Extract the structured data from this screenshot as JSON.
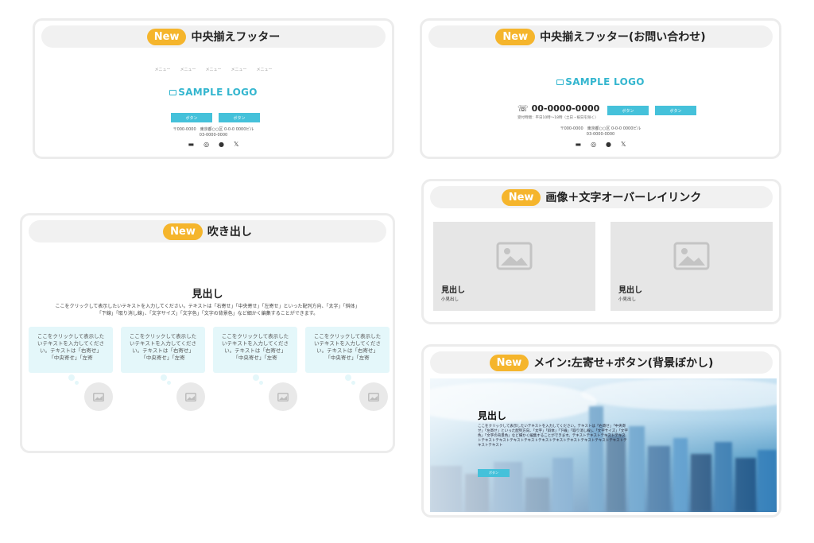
{
  "cards": {
    "footer_center": {
      "badge": "New",
      "title": "中央揃えフッター"
    },
    "footer_contact": {
      "badge": "New",
      "title": "中央揃えフッター(お問い合わせ)"
    },
    "overlay": {
      "badge": "New",
      "title": "画像＋文字オーバーレイリンク"
    },
    "bubble": {
      "badge": "New",
      "title": "吹き出し"
    },
    "hero": {
      "badge": "New",
      "title": "メイン:左寄せ+ボタン(背景ぼかし)"
    }
  },
  "footer": {
    "nav_items": [
      "メニュー",
      "メニュー",
      "メニュー",
      "メニュー",
      "メニュー"
    ],
    "logo": "SAMPLE LOGO",
    "button_label": "ボタン",
    "address_line1": "〒000-0000　東京都○○区 0-0-0 0000ビル",
    "address_line2": "03-0000-0000",
    "phone": "00-0000-0000",
    "phone_sub": "受付時間：平日10時〜18時（土日・祝日を除く）"
  },
  "bubble_section": {
    "heading": "見出し",
    "paragraph_line1": "ここをクリックして表示したいテキストを入力してください。テキストは「右寄せ」「中央寄せ」「左寄せ」といった配列方向、「太字」「斜体」",
    "paragraph_line2": "「下線」「取り消し線」、「文字サイズ」「文字色」「文字の背景色」など細かく編集することができます。",
    "bubble_text": "ここをクリックして表示したいテキストを入力してください。テキストは「右寄せ」「中央寄せ」「左寄"
  },
  "overlay_section": {
    "items": [
      {
        "heading": "見出し",
        "sub": "小見出し"
      },
      {
        "heading": "見出し",
        "sub": "小見出し"
      }
    ]
  },
  "hero_section": {
    "heading": "見出し",
    "paragraph": "ここをクリックして表示したいテキストを入力してください。テキストは「右寄せ」「中央寄せ」「左寄せ」といった配列方向、「太字」「斜体」「下線」「取り消し線」、「文字サイズ」「文字色」「文字の背景色」など細かく編集することができます。テキストテキストテキストテキストテキストテキストテキストテキストテキストテキストテキストテキストテキストテキストテキストテキスト",
    "button_label": "ボタン"
  },
  "colors": {
    "badge": "#f5b52c",
    "accent": "#45c1da",
    "logo": "#34b6cf",
    "bubble": "#e4f7fa"
  },
  "icons": [
    "image-placeholder-icon",
    "phone-icon",
    "youtube-icon",
    "instagram-icon",
    "facebook-icon",
    "x-icon"
  ]
}
